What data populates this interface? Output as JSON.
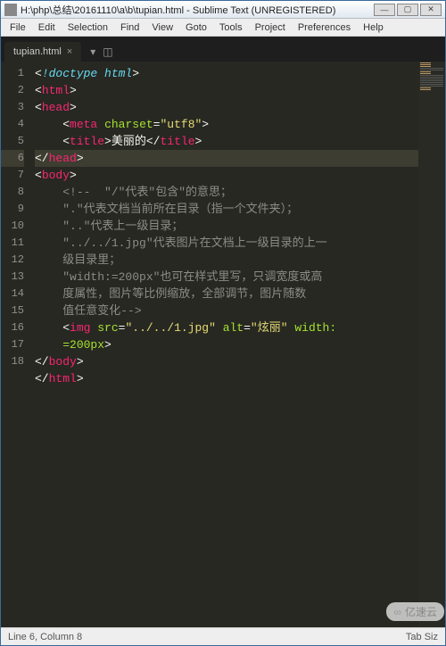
{
  "title": "H:\\php\\总结\\20161110\\a\\b\\tupian.html - Sublime Text (UNREGISTERED)",
  "menu": {
    "file": "File",
    "edit": "Edit",
    "selection": "Selection",
    "find": "Find",
    "view": "View",
    "goto": "Goto",
    "tools": "Tools",
    "project": "Project",
    "preferences": "Preferences",
    "help": "Help"
  },
  "tab": {
    "name": "tupian.html",
    "close": "×"
  },
  "gutter": [
    "1",
    "2",
    "3",
    "4",
    "5",
    "6",
    "7",
    "8",
    "9",
    "10",
    "11",
    "",
    "12",
    "",
    "13",
    "14",
    "15",
    "16",
    "17",
    "18"
  ],
  "code": {
    "l1_doctype": "!doctype html",
    "l2_tag": "html",
    "l3_tag": "head",
    "l4_tag": "meta",
    "l4_attr": "charset",
    "l4_val": "\"utf8\"",
    "l5_tag": "title",
    "l5_text": "美丽的",
    "l6_tag": "head",
    "l7_tag": "body",
    "l8_c1": "<!--  \"/\"代表\"包含\"的意思；",
    "l9_c": "\".\"代表文档当前所在目录（指一个文件夹）；",
    "l10_c": "\"..\"代表上一级目录；",
    "l11_c1": "\"../../1.jpg\"代表图片在文档上一级目录的上一",
    "l11_c2": "级目录里；",
    "l12_c1": "\"width:=200px\"也可在样式里写，只调宽度或高",
    "l12_c2": "度属性，图片等比例缩放，全部调节，图片随数",
    "l12_c3": "值任意变化-->",
    "l13_tag": "img",
    "l13_a1": "src",
    "l13_v1": "\"../../1.jpg\"",
    "l13_a2": "alt",
    "l13_v2": "\"炫丽\"",
    "l13_a3": "width:",
    "l14_v": "=200px",
    "l15_tag": "body",
    "l16_tag": "html"
  },
  "status": {
    "left": "Line 6, Column 8",
    "right": "Tab Siz"
  },
  "watermark": {
    "icon": "∞",
    "text": "亿速云"
  }
}
